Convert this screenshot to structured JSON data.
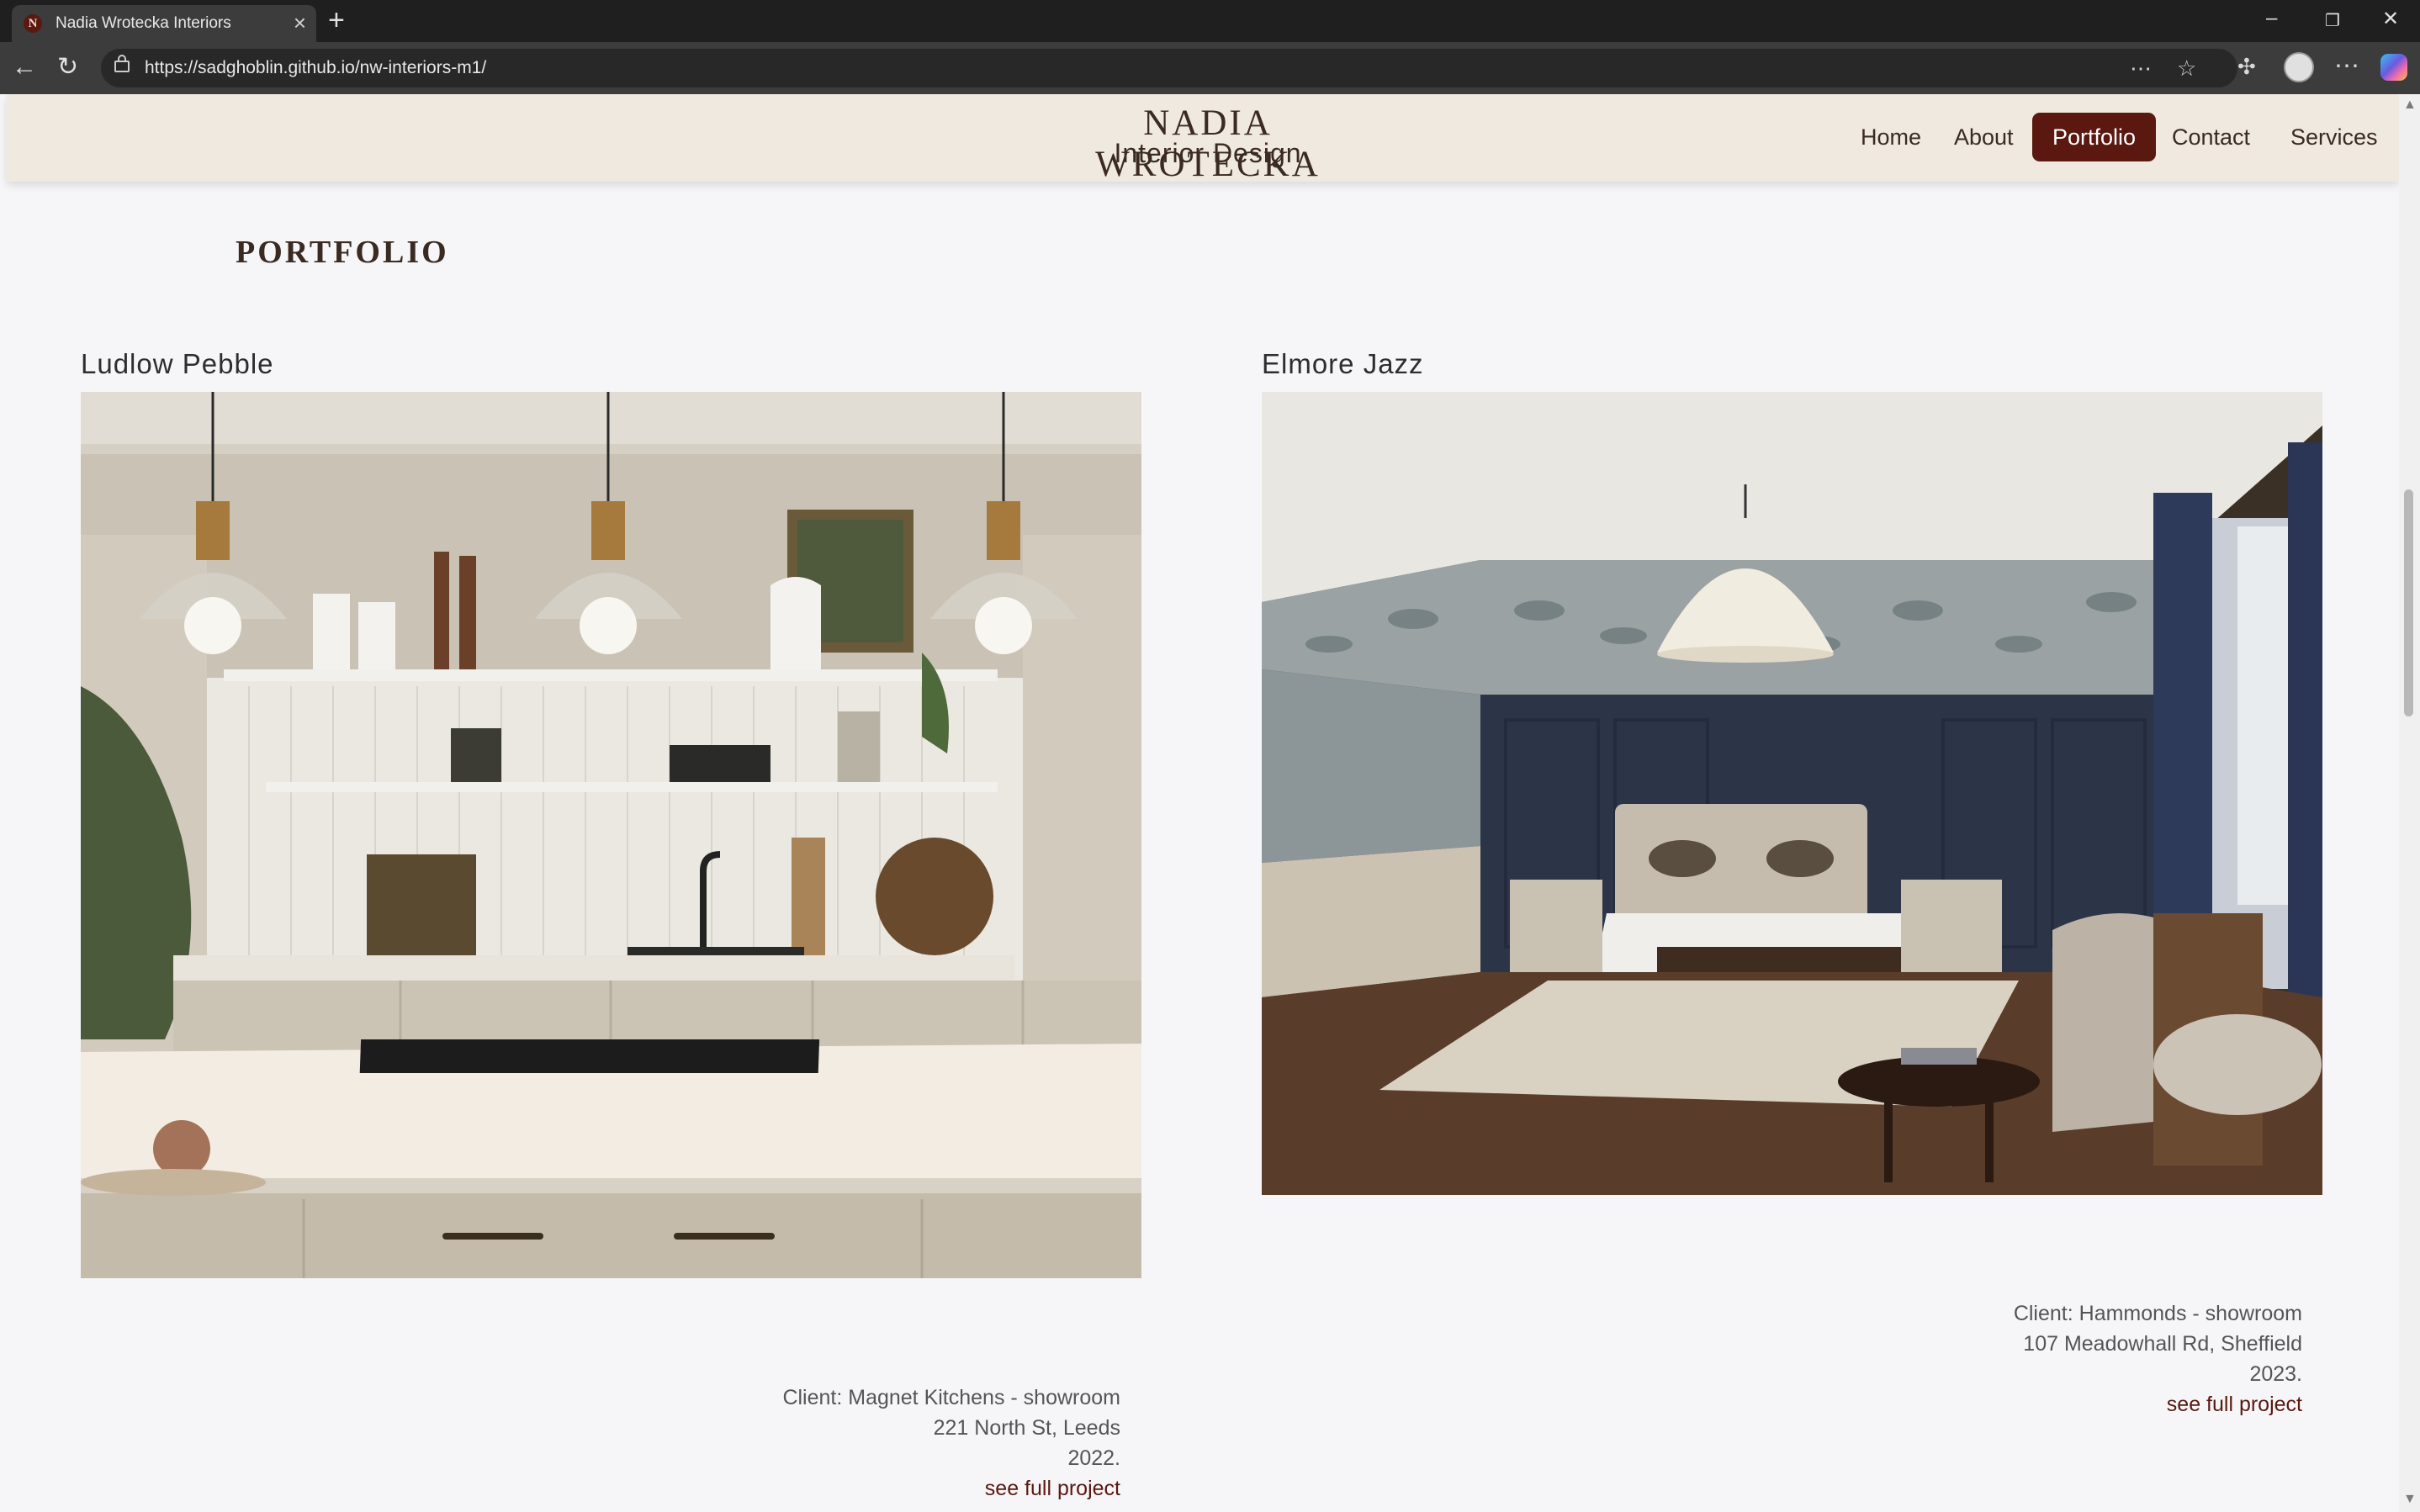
{
  "browser": {
    "tab_title": "Nadia Wrotecka Interiors",
    "favicon_letter": "N",
    "url": "https://sadghoblin.github.io/nw-interiors-m1/"
  },
  "site": {
    "brand_name": "NADIA WROTECKA",
    "brand_sub": "Interior Design",
    "nav": [
      {
        "label": "Home",
        "active": false
      },
      {
        "label": "About",
        "active": false
      },
      {
        "label": "Portfolio",
        "active": true
      },
      {
        "label": "Contact",
        "active": false
      },
      {
        "label": "Services",
        "active": false
      }
    ],
    "accent_color": "#5a1810",
    "header_bg": "#efe9df"
  },
  "page": {
    "heading": "PORTFOLIO",
    "projects": [
      {
        "title": "Ludlow Pebble",
        "client": "Client: Magnet Kitchens - showroom",
        "address": "221 North St, Leeds",
        "year": "2022.",
        "link": "see full project",
        "image": "kitchen-photo"
      },
      {
        "title": "Elmore Jazz",
        "client": "Client: Hammonds - showroom",
        "address": "107 Meadowhall Rd, Sheffield",
        "year": "2023.",
        "link": "see full project",
        "image": "bedroom-photo"
      }
    ]
  }
}
